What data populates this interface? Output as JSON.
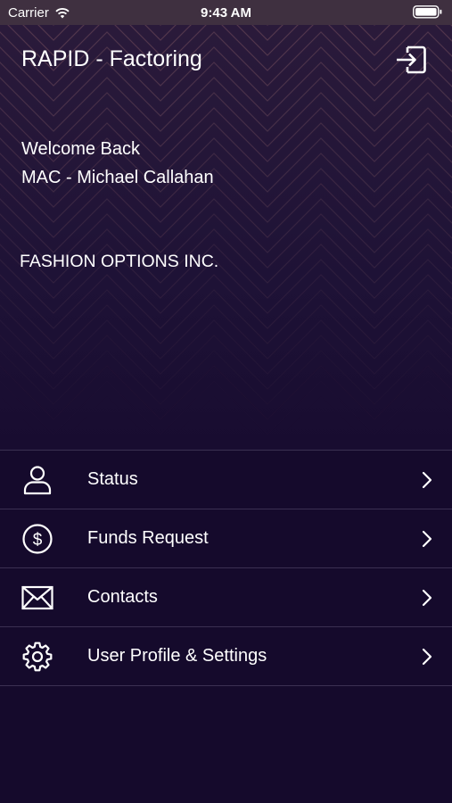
{
  "status_bar": {
    "carrier": "Carrier",
    "time": "9:43 AM",
    "wifi_icon": "wifi-icon",
    "battery_icon": "battery-icon"
  },
  "header": {
    "title": "RAPID - Factoring",
    "logout_icon": "logout-icon"
  },
  "welcome": {
    "line1": "Welcome Back",
    "line2": "MAC - Michael Callahan"
  },
  "company": "FASHION OPTIONS INC.",
  "menu": {
    "items": [
      {
        "label": "Status",
        "icon": "person-icon"
      },
      {
        "label": "Funds Request",
        "icon": "dollar-circle-icon"
      },
      {
        "label": "Contacts",
        "icon": "envelope-icon"
      },
      {
        "label": "User Profile & Settings",
        "icon": "gear-icon"
      }
    ]
  },
  "colors": {
    "background": "#150a2c",
    "status_bar": "#3f3040",
    "divider": "#3b3052",
    "text": "#ffffff"
  }
}
